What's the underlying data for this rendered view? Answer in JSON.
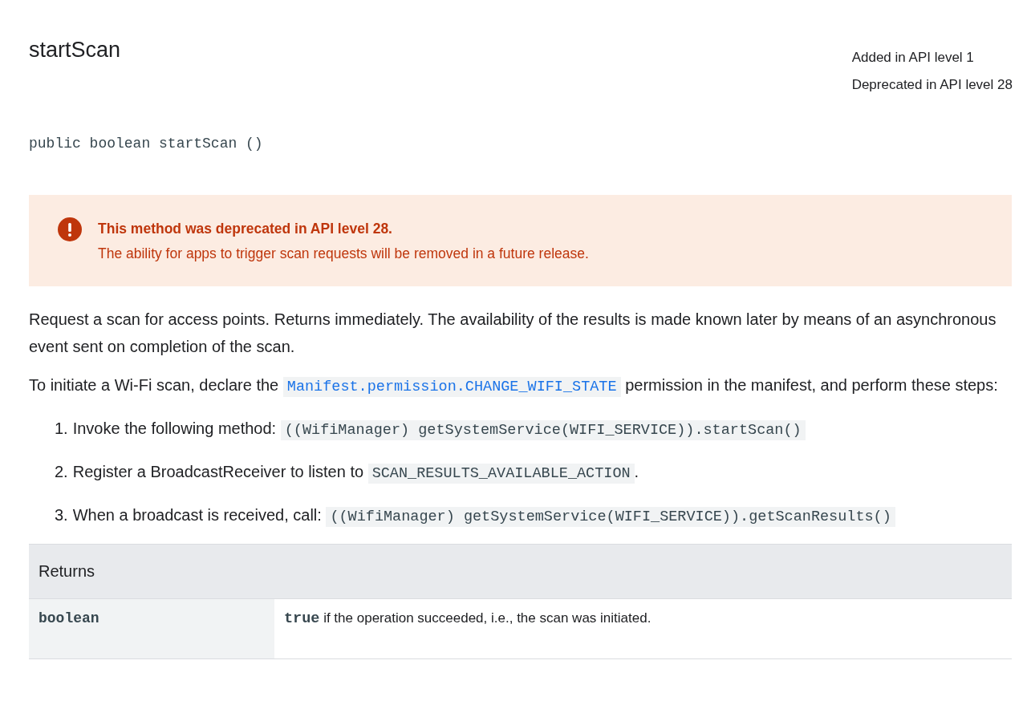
{
  "title": "startScan",
  "api_info": [
    "Added in API level 1",
    "Deprecated in API level 28"
  ],
  "signature": "public boolean startScan ()",
  "deprecation": {
    "title": "This method was deprecated in API level 28.",
    "message": "The ability for apps to trigger scan requests will be removed in a future release."
  },
  "paragraphs": [
    {
      "parts": [
        {
          "kind": "text",
          "text": "Request a scan for access points. Returns immediately. The availability of the results is made known later by means of an asynchronous event sent on completion of the scan."
        }
      ]
    },
    {
      "parts": [
        {
          "kind": "text",
          "text": "To initiate a Wi-Fi scan, declare the "
        },
        {
          "kind": "link",
          "text": "Manifest.permission.CHANGE_WIFI_STATE"
        },
        {
          "kind": "text",
          "text": " permission in the manifest, and perform these steps:"
        }
      ]
    }
  ],
  "steps": [
    {
      "number": "1.",
      "parts": [
        {
          "kind": "text",
          "text": "Invoke the following method: "
        },
        {
          "kind": "code",
          "text": "((WifiManager) getSystemService(WIFI_SERVICE)).startScan()"
        }
      ]
    },
    {
      "number": "2.",
      "parts": [
        {
          "kind": "text",
          "text": "Register a BroadcastReceiver to listen to "
        },
        {
          "kind": "code",
          "text": "SCAN_RESULTS_AVAILABLE_ACTION"
        },
        {
          "kind": "text",
          "text": "."
        }
      ]
    },
    {
      "number": "3.",
      "parts": [
        {
          "kind": "text",
          "text": "When a broadcast is received, call: "
        },
        {
          "kind": "code",
          "text": "((WifiManager) getSystemService(WIFI_SERVICE)).getScanResults()"
        }
      ]
    }
  ],
  "returns": {
    "heading": "Returns",
    "type": "boolean",
    "description": [
      {
        "kind": "code",
        "text": "true"
      },
      {
        "kind": "text",
        "text": " if the operation succeeded, i.e., the scan was initiated."
      }
    ]
  }
}
